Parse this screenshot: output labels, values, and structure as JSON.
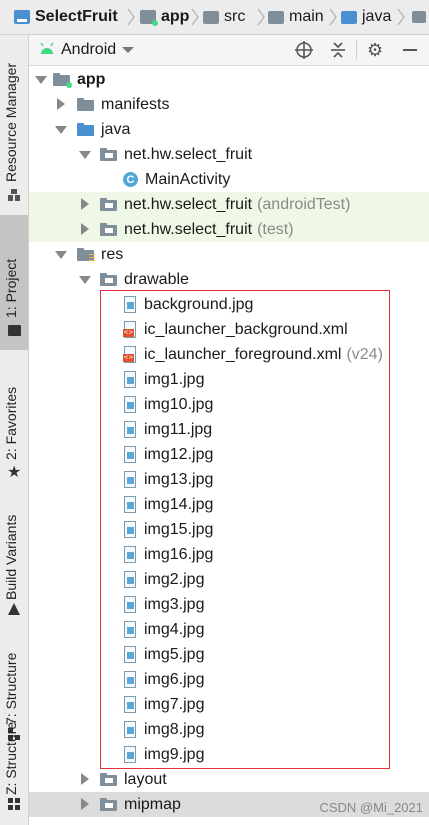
{
  "breadcrumb": [
    {
      "label": "SelectFruit",
      "icon": "project-folder-icon"
    },
    {
      "label": "app",
      "icon": "module-folder-icon"
    },
    {
      "label": "src",
      "icon": "folder-icon"
    },
    {
      "label": "main",
      "icon": "folder-icon"
    },
    {
      "label": "java",
      "icon": "source-folder-icon"
    }
  ],
  "left_tabs": [
    {
      "label": "Resource Manager"
    },
    {
      "label": "1: Project"
    },
    {
      "label": "2: Favorites"
    },
    {
      "label": "Build Variants"
    },
    {
      "label": "7: Structure"
    },
    {
      "label": "Z: Structure"
    }
  ],
  "project_header": {
    "view_label": "Android"
  },
  "tree": {
    "app": "app",
    "manifests": "manifests",
    "java": "java",
    "pkg_main": "net.hw.select_fruit",
    "main_activity": "MainActivity",
    "pkg_android_test": "net.hw.select_fruit",
    "pkg_android_test_hint": "(androidTest)",
    "pkg_test": "net.hw.select_fruit",
    "pkg_test_hint": "(test)",
    "res": "res",
    "drawable": "drawable",
    "drawable_files": [
      {
        "name": "background.jpg",
        "type": "image",
        "hint": ""
      },
      {
        "name": "ic_launcher_background.xml",
        "type": "xml",
        "hint": ""
      },
      {
        "name": "ic_launcher_foreground.xml",
        "type": "xml",
        "hint": "(v24)"
      },
      {
        "name": "img1.jpg",
        "type": "image",
        "hint": ""
      },
      {
        "name": "img10.jpg",
        "type": "image",
        "hint": ""
      },
      {
        "name": "img11.jpg",
        "type": "image",
        "hint": ""
      },
      {
        "name": "img12.jpg",
        "type": "image",
        "hint": ""
      },
      {
        "name": "img13.jpg",
        "type": "image",
        "hint": ""
      },
      {
        "name": "img14.jpg",
        "type": "image",
        "hint": ""
      },
      {
        "name": "img15.jpg",
        "type": "image",
        "hint": ""
      },
      {
        "name": "img16.jpg",
        "type": "image",
        "hint": ""
      },
      {
        "name": "img2.jpg",
        "type": "image",
        "hint": ""
      },
      {
        "name": "img3.jpg",
        "type": "image",
        "hint": ""
      },
      {
        "name": "img4.jpg",
        "type": "image",
        "hint": ""
      },
      {
        "name": "img5.jpg",
        "type": "image",
        "hint": ""
      },
      {
        "name": "img6.jpg",
        "type": "image",
        "hint": ""
      },
      {
        "name": "img7.jpg",
        "type": "image",
        "hint": ""
      },
      {
        "name": "img8.jpg",
        "type": "image",
        "hint": ""
      },
      {
        "name": "img9.jpg",
        "type": "image",
        "hint": ""
      }
    ],
    "layout": "layout",
    "mipmap": "mipmap"
  },
  "watermark": "CSDN @Mi_2021",
  "colors": {
    "highlight_box": "#e8303a",
    "test_row_bg": "#eff8e6",
    "selected_row_bg": "#dcdcdc"
  }
}
